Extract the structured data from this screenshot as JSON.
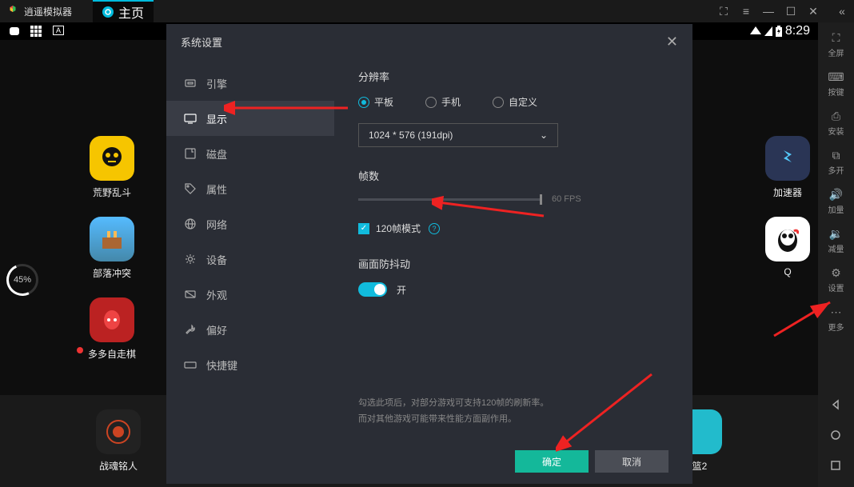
{
  "titlebar": {
    "app_name": "逍遥模拟器",
    "tab_home": "主页"
  },
  "statusbar": {
    "time": "8:29"
  },
  "progress": {
    "value": "45%"
  },
  "apps_left": [
    {
      "label": "荒野乱斗",
      "bg": "#f6c500"
    },
    {
      "label": "部落冲突",
      "bg": "#4a8"
    },
    {
      "label": "多多自走棋",
      "bg": "#b22"
    }
  ],
  "apps_right": [
    {
      "label": "加速器",
      "bg": "#2a3555"
    },
    {
      "label": "Q",
      "bg": "#fff"
    }
  ],
  "dock": [
    {
      "label": "战魂铭人",
      "bg": "#222"
    },
    {
      "label": "篮2",
      "bg": "#2bc"
    }
  ],
  "modal": {
    "title": "系统设置",
    "sidebar": [
      "引擎",
      "显示",
      "磁盘",
      "属性",
      "网络",
      "设备",
      "外观",
      "偏好",
      "快捷键"
    ],
    "active_idx": 1,
    "resolution": {
      "title": "分辨率",
      "options": [
        "平板",
        "手机",
        "自定义"
      ],
      "selected": 0,
      "dropdown": "1024 * 576 (191dpi)"
    },
    "fps": {
      "title": "帧数",
      "value": "60 FPS",
      "checkbox_label": "120帧模式"
    },
    "antishake": {
      "title": "画面防抖动",
      "toggle_label": "开"
    },
    "hint1": "勾选此项后，对部分游戏可支持120帧的刷新率。",
    "hint2": "而对其他游戏可能带来性能方面副作用。",
    "ok": "确定",
    "cancel": "取消"
  },
  "rsidebar": {
    "items": [
      "全屏",
      "按键",
      "安装",
      "多开",
      "加量",
      "减量",
      "设置",
      "更多"
    ]
  }
}
